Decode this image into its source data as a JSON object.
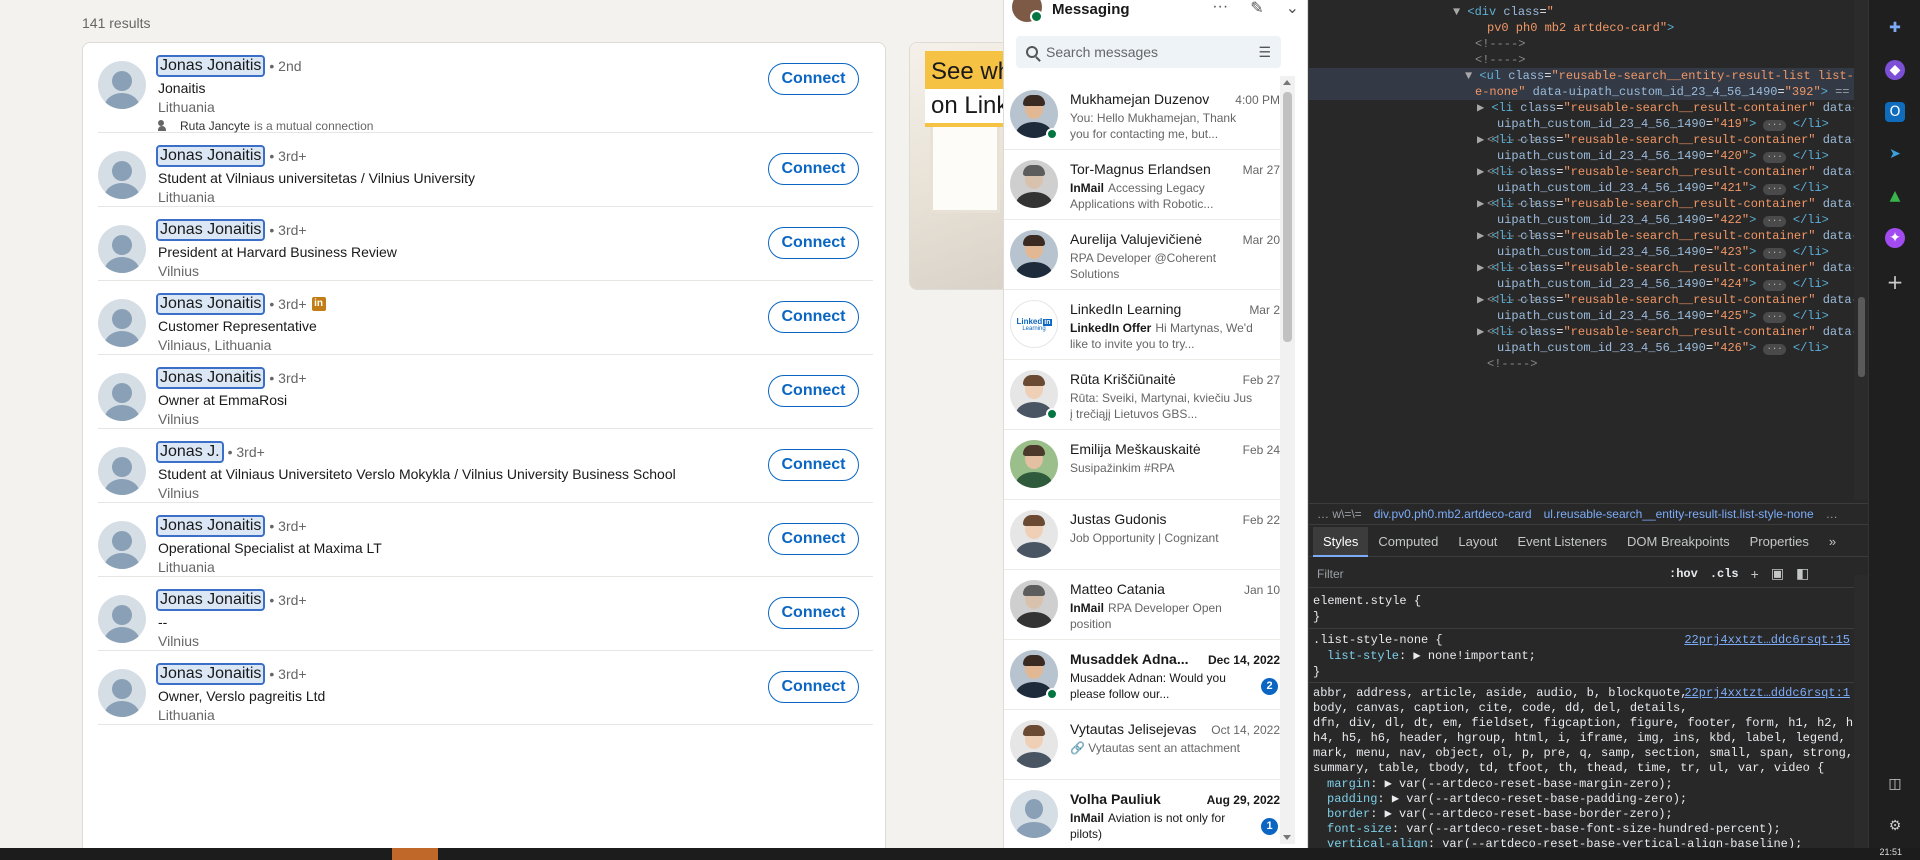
{
  "search": {
    "results_count": "141 results",
    "connect_label": "Connect",
    "results": [
      {
        "name": "Jonas Jonaitis",
        "degree": "• 2nd",
        "headline": "Jonaitis",
        "location": "Lithuania",
        "mutual_name": "Ruta Jancyte",
        "mutual_text": "is a mutual connection",
        "badge": false
      },
      {
        "name": "Jonas Jonaitis",
        "degree": "• 3rd+",
        "headline": "Student at Vilniaus universitetas / Vilnius University",
        "location": "Lithuania",
        "badge": false
      },
      {
        "name": "Jonas Jonaitis",
        "degree": "• 3rd+",
        "headline": "President at Harvard Business Review",
        "location": "Vilnius",
        "badge": false
      },
      {
        "name": "Jonas Jonaitis",
        "degree": "• 3rd+",
        "headline": "Customer Representative",
        "location": "Vilniaus, Lithuania",
        "badge": true
      },
      {
        "name": "Jonas Jonaitis",
        "degree": "• 3rd+",
        "headline": "Owner at EmmaRosi",
        "location": "Vilnius",
        "badge": false
      },
      {
        "name": "Jonas J.",
        "degree": "• 3rd+",
        "headline": "Student at Vilniaus Universiteto Verslo Mokykla / Vilnius University Business School",
        "location": "Vilnius",
        "badge": false
      },
      {
        "name": "Jonas Jonaitis",
        "degree": "• 3rd+",
        "headline": "Operational Specialist at Maxima LT",
        "location": "Lithuania",
        "badge": false
      },
      {
        "name": "Jonas Jonaitis",
        "degree": "• 3rd+",
        "headline": "--",
        "location": "Vilnius",
        "badge": false
      },
      {
        "name": "Jonas Jonaitis",
        "degree": "• 3rd+",
        "headline": "Owner, Verslo pagreitis Ltd",
        "location": "Lithuania",
        "badge": false
      }
    ]
  },
  "ad": {
    "line1": "See wh",
    "line2": "on Link"
  },
  "messaging": {
    "title": "Messaging",
    "search_placeholder": "Search messages",
    "conversations": [
      {
        "name": "Mukhamejan Duzenov",
        "date": "4:00 PM",
        "tag": "",
        "preview": "You: Hello Mukhamejan, Thank you for contacting me, but...",
        "unread": false,
        "online": true,
        "avatar": "photo-dark"
      },
      {
        "name": "Tor-Magnus Erlandsen",
        "date": "Mar 27",
        "tag": "InMail",
        "preview": "Accessing Legacy Applications with Robotic...",
        "unread": false,
        "online": false,
        "avatar": "photo-grey"
      },
      {
        "name": "Aurelija Valujevičienė",
        "date": "Mar 20",
        "tag": "",
        "preview": "RPA Developer @Coherent Solutions",
        "unread": false,
        "online": false,
        "avatar": "photo-dark"
      },
      {
        "name": "LinkedIn Learning",
        "date": "Mar 2",
        "tag": "LinkedIn Offer",
        "preview": "Hi Martynas, We'd like to invite you to try...",
        "unread": false,
        "online": false,
        "avatar": "logo"
      },
      {
        "name": "Rūta Kriščiūnaitė",
        "date": "Feb 27",
        "tag": "",
        "preview": "Rūta: Sveiki, Martynai, kviečiu Jus į trečiąjį Lietuvos GBS...",
        "unread": false,
        "online": true,
        "avatar": "photo-light"
      },
      {
        "name": "Emilija Meškauskaitė",
        "date": "Feb 24",
        "tag": "",
        "preview": "Susipažinkim #RPA",
        "unread": false,
        "online": false,
        "avatar": "photo-green"
      },
      {
        "name": "Justas Gudonis",
        "date": "Feb 22",
        "tag": "",
        "preview": "Job Opportunity | Cognizant",
        "unread": false,
        "online": false,
        "avatar": "photo-light"
      },
      {
        "name": "Matteo Catania",
        "date": "Jan 10",
        "tag": "InMail",
        "preview": "RPA Developer Open position",
        "unread": false,
        "online": false,
        "avatar": "photo-grey"
      },
      {
        "name": "Musaddek Adna...",
        "date": "Dec 14, 2022",
        "tag": "",
        "preview": "Musaddek Adnan: Would you please follow our...",
        "unread": true,
        "online": true,
        "badge": "2",
        "avatar": "photo-dark"
      },
      {
        "name": "Vytautas Jelisejevas",
        "date": "Oct 14, 2022",
        "tag": "",
        "preview": "🔗 Vytautas sent an attachment",
        "unread": false,
        "online": false,
        "avatar": "photo-light"
      },
      {
        "name": "Volha Pauliuk",
        "date": "Aug 29, 2022",
        "tag": "InMail",
        "preview": "Aviation is not only for pilots)",
        "unread": true,
        "online": false,
        "badge": "1",
        "avatar": "ghost"
      }
    ]
  },
  "devtools": {
    "dom_lines": [
      {
        "indent": 144,
        "html": "▼ <div class=\"",
        "kind": "open"
      },
      {
        "indent": 178,
        "html": "pv0 ph0 mb2 artdeco-card\">",
        "kind": "cont"
      },
      {
        "indent": 166,
        "html": "<!---->",
        "kind": "comment"
      },
      {
        "indent": 166,
        "html": "<!---->",
        "kind": "comment"
      },
      {
        "indent": 156,
        "html": "▼ <ul class=\"reusable-search__entity-result-list list-styl",
        "kind": "sel"
      },
      {
        "indent": 166,
        "html": "e-none\" data-uipath_custom_id_23_4_56_1490=\"392\"> == $0",
        "kind": "sel2"
      },
      {
        "indent": 168,
        "html": "▶ <li class=\"reusable-search__result-container\" data-",
        "kind": "li",
        "id": "419"
      },
      {
        "indent": 168,
        "html": "▶ <li class=\"reusable-search__result-container\" data-",
        "kind": "li",
        "id": "420"
      },
      {
        "indent": 168,
        "html": "▶ <li class=\"reusable-search__result-container\" data-",
        "kind": "li",
        "id": "421"
      },
      {
        "indent": 168,
        "html": "▶ <li class=\"reusable-search__result-container\" data-",
        "kind": "li",
        "id": "422"
      },
      {
        "indent": 168,
        "html": "▶ <li class=\"reusable-search__result-container\" data-",
        "kind": "li",
        "id": "423"
      },
      {
        "indent": 168,
        "html": "▶ <li class=\"reusable-search__result-container\" data-",
        "kind": "li",
        "id": "424"
      },
      {
        "indent": 168,
        "html": "▶ <li class=\"reusable-search__result-container\" data-",
        "kind": "li",
        "id": "425"
      },
      {
        "indent": 168,
        "html": "▶ <li class=\"reusable-search__result-container\" data-",
        "kind": "li",
        "id": "426"
      }
    ],
    "breadcrumbs": [
      "… w\\=\\=",
      "div.pv0.ph0.mb2.artdeco-card",
      "ul.reusable-search__entity-result-list.list-style-none",
      "…"
    ],
    "tabs": [
      "Styles",
      "Computed",
      "Layout",
      "Event Listeners",
      "DOM Breakpoints",
      "Properties",
      "»"
    ],
    "active_tab": "Styles",
    "filter_placeholder": "Filter",
    "hov": ":hov",
    "cls": ".cls",
    "styles": {
      "element_style": "element.style {",
      "close": "}",
      "rule1_selector": ".list-style-none {",
      "rule1_prop": "list-style",
      "rule1_value": ": ▶ none!important;",
      "rule1_link": "22prj4xxtzt…ddc6rsqt:15",
      "rule2_selector_1": "abbr, address, article, aside, audio, b, blockquote,",
      "rule2_selector_2": "body, canvas, caption, cite, code, dd, del, details,",
      "rule2_selector_3": "dfn, div, dl, dt, em, fieldset, figcaption, figure, footer, form, h1, h2, h3,",
      "rule2_selector_4": "h4, h5, h6, header, hgroup, html, i, iframe, img, ins, kbd, label, legend, li,",
      "rule2_selector_5": "mark, menu, nav, object, ol, p, pre, q, samp, section, small, span, strong,",
      "rule2_selector_6": "summary, table, tbody, td, tfoot, th, thead, time, tr, ul, var, video {",
      "rule2_link": "22prj4xxtzt…dddc6rsqt:1",
      "decls": [
        {
          "prop": "margin",
          "value": ": ▶ var(--artdeco-reset-base-margin-zero);"
        },
        {
          "prop": "padding",
          "value": ": ▶ var(--artdeco-reset-base-padding-zero);"
        },
        {
          "prop": "border",
          "value": ": ▶ var(--artdeco-reset-base-border-zero);"
        },
        {
          "prop": "font-size",
          "value": ": var(--artdeco-reset-base-font-size-hundred-percent);"
        },
        {
          "prop": "vertical-align",
          "value": ": var(--artdeco-reset-base-vertical-align-baseline);"
        }
      ]
    }
  },
  "taskbar": {
    "clock": "21:51"
  }
}
